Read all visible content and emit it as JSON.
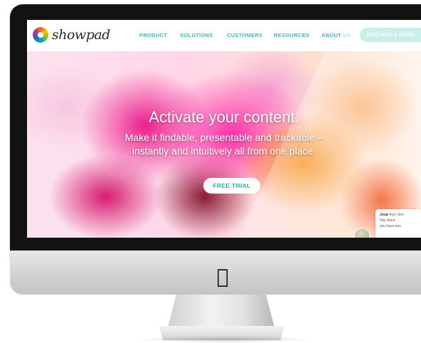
{
  "site": {
    "logo_text": "showpad",
    "nav": {
      "items": [
        "PRODUCT",
        "SOLUTIONS",
        "CUSTOMERS",
        "RESOURCES"
      ],
      "about_prefix": "ABOUT",
      "about_suffix": "US",
      "cta": "REQUEST A DEMO"
    },
    "hero": {
      "title": "Activate your content.",
      "subtitle_line1": "Make it findable, presentable and trackable –",
      "subtitle_line2": "instantly and intuitively all from one place.",
      "button": "FREE TRIAL"
    },
    "chat": {
      "name": "Joop",
      "line1": "from Sho",
      "line2": "Hey there",
      "line3": "you have any"
    }
  },
  "device": {
    "logo_icon": "apple-icon"
  },
  "colors": {
    "accent": "#3db9b0",
    "button_text": "#2ab4a8",
    "cta_bg": "#c8efea",
    "bezel": "#121212",
    "chin": "#d6d7d9"
  }
}
